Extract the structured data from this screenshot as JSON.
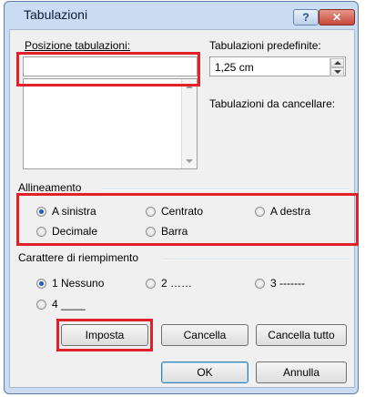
{
  "window": {
    "title": "Tabulazioni",
    "help_label": "?",
    "close_label": "✕"
  },
  "positions": {
    "label": "Posizione tabulazioni:",
    "value": "",
    "list_items": []
  },
  "default_tabs": {
    "label": "Tabulazioni predefinite:",
    "value": "1,25 cm"
  },
  "clear_tabs": {
    "label": "Tabulazioni da cancellare:"
  },
  "alignment": {
    "label": "Allineamento",
    "options": [
      {
        "label": "A sinistra",
        "checked": true
      },
      {
        "label": "Centrato",
        "checked": false
      },
      {
        "label": "A destra",
        "checked": false
      },
      {
        "label": "Decimale",
        "checked": false
      },
      {
        "label": "Barra",
        "checked": false
      }
    ]
  },
  "leader": {
    "label": "Carattere di riempimento",
    "options": [
      {
        "label": "1 Nessuno",
        "checked": true
      },
      {
        "label": "2 ……",
        "checked": false
      },
      {
        "label": "3 -------",
        "checked": false
      },
      {
        "label": "4 ____",
        "checked": false
      }
    ]
  },
  "buttons": {
    "set": "Imposta",
    "clear": "Cancella",
    "clear_all": "Cancella tutto",
    "ok": "OK",
    "cancel": "Annulla"
  },
  "colors": {
    "highlight": "#e0202a",
    "radio_selected": "#1f5fb0"
  }
}
